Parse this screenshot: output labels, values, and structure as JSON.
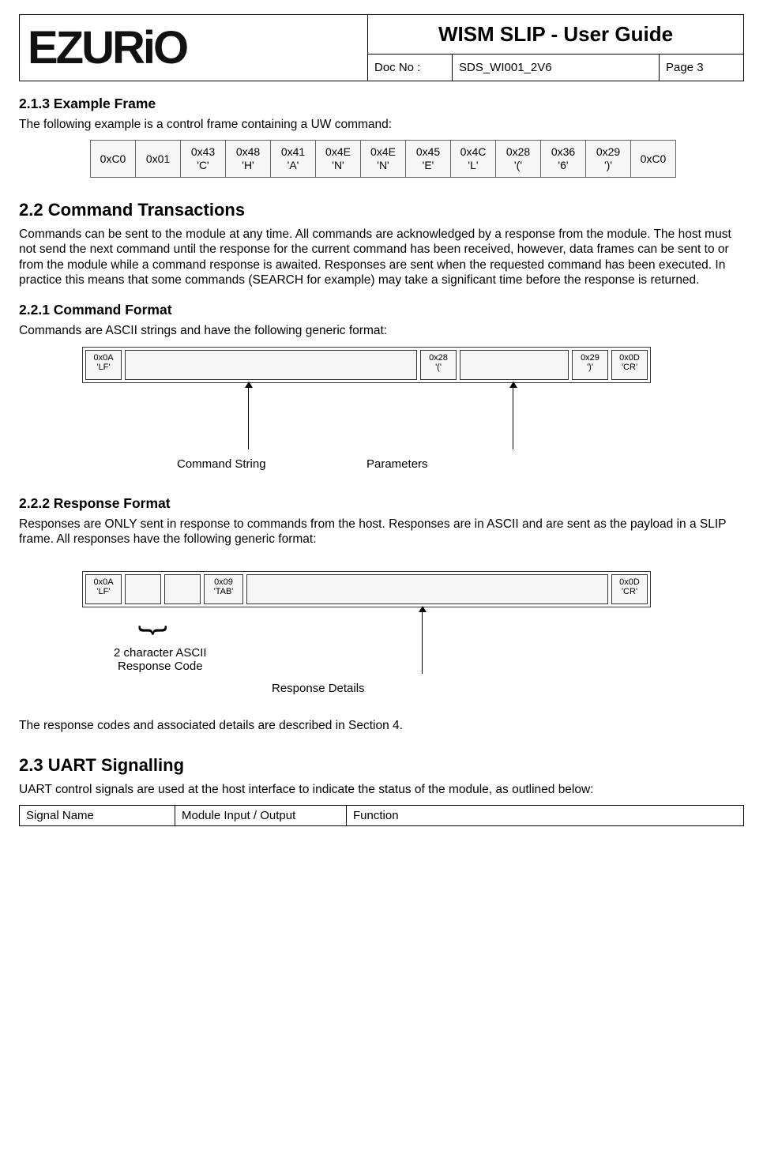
{
  "header": {
    "logo": "EZURiO",
    "title": "WISM SLIP - User Guide",
    "docno_label": "Doc No :",
    "docno_value": "SDS_WI001_2V6",
    "page": "Page 3"
  },
  "sec213": {
    "heading": "2.1.3  Example Frame",
    "text": "The following example is a control frame containing a UW command:",
    "cells": [
      {
        "t": "0xC0"
      },
      {
        "t": "0x01"
      },
      {
        "t": "0x43",
        "c": "'C'"
      },
      {
        "t": "0x48",
        "c": "'H'"
      },
      {
        "t": "0x41",
        "c": "'A'"
      },
      {
        "t": "0x4E",
        "c": "'N'"
      },
      {
        "t": "0x4E",
        "c": "'N'"
      },
      {
        "t": "0x45",
        "c": "'E'"
      },
      {
        "t": "0x4C",
        "c": "'L'"
      },
      {
        "t": "0x28",
        "c": "'('"
      },
      {
        "t": "0x36",
        "c": "'6'"
      },
      {
        "t": "0x29",
        "c": "')'"
      },
      {
        "t": "0xC0"
      }
    ]
  },
  "sec22": {
    "heading": "2.2  Command Transactions",
    "text": "Commands can be sent to the module at any time. All commands are acknowledged by a response from the module. The host must not send the next command until the response for the current command has been received, however, data frames can be sent to or from the module while a command response is awaited. Responses are sent when the requested command has been executed. In practice this means that some commands (SEARCH for example) may take a significant time before the response is returned."
  },
  "sec221": {
    "heading": "2.2.1  Command Format",
    "text": "Commands are ASCII strings and have the following generic format:",
    "diagram": {
      "box_lf_t": "0x0A",
      "box_lf_c": "'LF'",
      "box_lp_t": "0x28",
      "box_lp_c": "'('",
      "box_rp_t": "0x29",
      "box_rp_c": "')'",
      "box_cr_t": "0x0D",
      "box_cr_c": "'CR'",
      "label_cmd": "Command String",
      "label_par": "Parameters"
    }
  },
  "sec222": {
    "heading": "2.2.2  Response Format",
    "text": "Responses are ONLY sent in response to commands from the host. Responses are in ASCII and are sent as the payload in a SLIP frame. All responses have the following generic format:",
    "diagram": {
      "box_lf_t": "0x0A",
      "box_lf_c": "'LF'",
      "box_tab_t": "0x09",
      "box_tab_c": "'TAB'",
      "box_cr_t": "0x0D",
      "box_cr_c": "'CR'",
      "label_code": "2 character ASCII\nResponse Code",
      "label_det": "Response Details"
    },
    "text_after": "The response codes and associated details are described in Section 4."
  },
  "sec23": {
    "heading": "2.3  UART Signalling",
    "text": "UART control signals are used at the host interface to indicate the status of the module, as outlined below:",
    "table_headers": {
      "c1": "Signal Name",
      "c2": "Module Input / Output",
      "c3": "Function"
    }
  }
}
